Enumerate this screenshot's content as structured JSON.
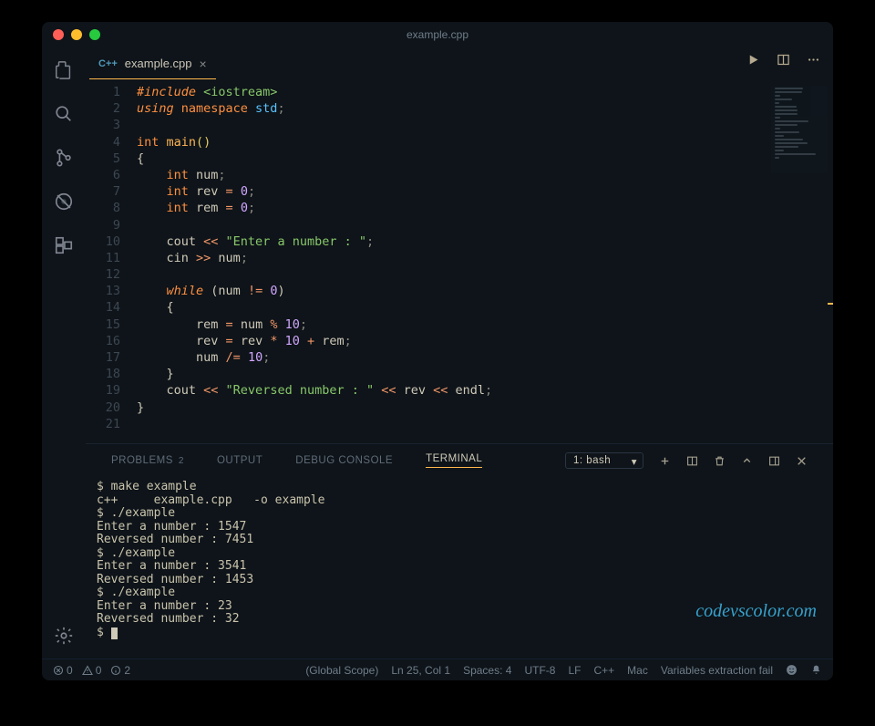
{
  "window": {
    "title": "example.cpp"
  },
  "tab": {
    "language_badge": "C++",
    "filename": "example.cpp"
  },
  "code": {
    "lines": [
      1,
      2,
      3,
      4,
      5,
      6,
      7,
      8,
      9,
      10,
      11,
      12,
      13,
      14,
      15,
      16,
      17,
      18,
      19,
      20,
      21
    ],
    "l1a": "#include",
    "l1b": " <iostream>",
    "l2a": "using",
    "l2b": " namespace",
    "l2c": " std",
    "l2d": ";",
    "l4a": "int",
    "l4b": " main",
    "l4c": "()",
    "l5": "{",
    "l6a": "    int",
    "l6b": " num",
    "l6c": ";",
    "l7a": "    int",
    "l7b": " rev ",
    "l7c": "=",
    "l7d": " 0",
    "l7e": ";",
    "l8a": "    int",
    "l8b": " rem ",
    "l8c": "=",
    "l8d": " 0",
    "l8e": ";",
    "l10a": "    cout ",
    "l10b": "<<",
    "l10c": " \"Enter a number : \"",
    "l10d": ";",
    "l11a": "    cin ",
    "l11b": ">>",
    "l11c": " num",
    "l11d": ";",
    "l13a": "    while",
    "l13b": " (num ",
    "l13c": "!=",
    "l13d": " 0",
    "l13e": ")",
    "l14": "    {",
    "l15a": "        rem ",
    "l15b": "=",
    "l15c": " num ",
    "l15d": "%",
    "l15e": " 10",
    "l15f": ";",
    "l16a": "        rev ",
    "l16b": "=",
    "l16c": " rev ",
    "l16d": "*",
    "l16e": " 10",
    "l16f": " +",
    "l16g": " rem",
    "l16h": ";",
    "l17a": "        num ",
    "l17b": "/=",
    "l17c": " 10",
    "l17d": ";",
    "l18": "    }",
    "l19a": "    cout ",
    "l19b": "<<",
    "l19c": " \"Reversed number : \"",
    "l19d": " <<",
    "l19e": " rev ",
    "l19f": "<<",
    "l19g": " endl",
    "l19h": ";",
    "l20": "}"
  },
  "panel": {
    "tabs": {
      "problems": "PROBLEMS",
      "problems_count": "2",
      "output": "OUTPUT",
      "debug": "DEBUG CONSOLE",
      "terminal": "TERMINAL"
    },
    "shell_select": "1: bash"
  },
  "terminal_lines": [
    "$ make example",
    "c++     example.cpp   -o example",
    "$ ./example",
    "Enter a number : 1547",
    "Reversed number : 7451",
    "$ ./example",
    "Enter a number : 3541",
    "Reversed number : 1453",
    "$ ./example",
    "Enter a number : 23",
    "Reversed number : 32"
  ],
  "terminal_prompt": "$ ",
  "watermark": "codevscolor.com",
  "status": {
    "errors": "0",
    "warnings": "0",
    "info": "2",
    "scope": "(Global Scope)",
    "position": "Ln 25, Col 1",
    "spaces": "Spaces: 4",
    "encoding": "UTF-8",
    "eol": "LF",
    "language": "C++",
    "os": "Mac",
    "extra": "Variables extraction fail"
  }
}
